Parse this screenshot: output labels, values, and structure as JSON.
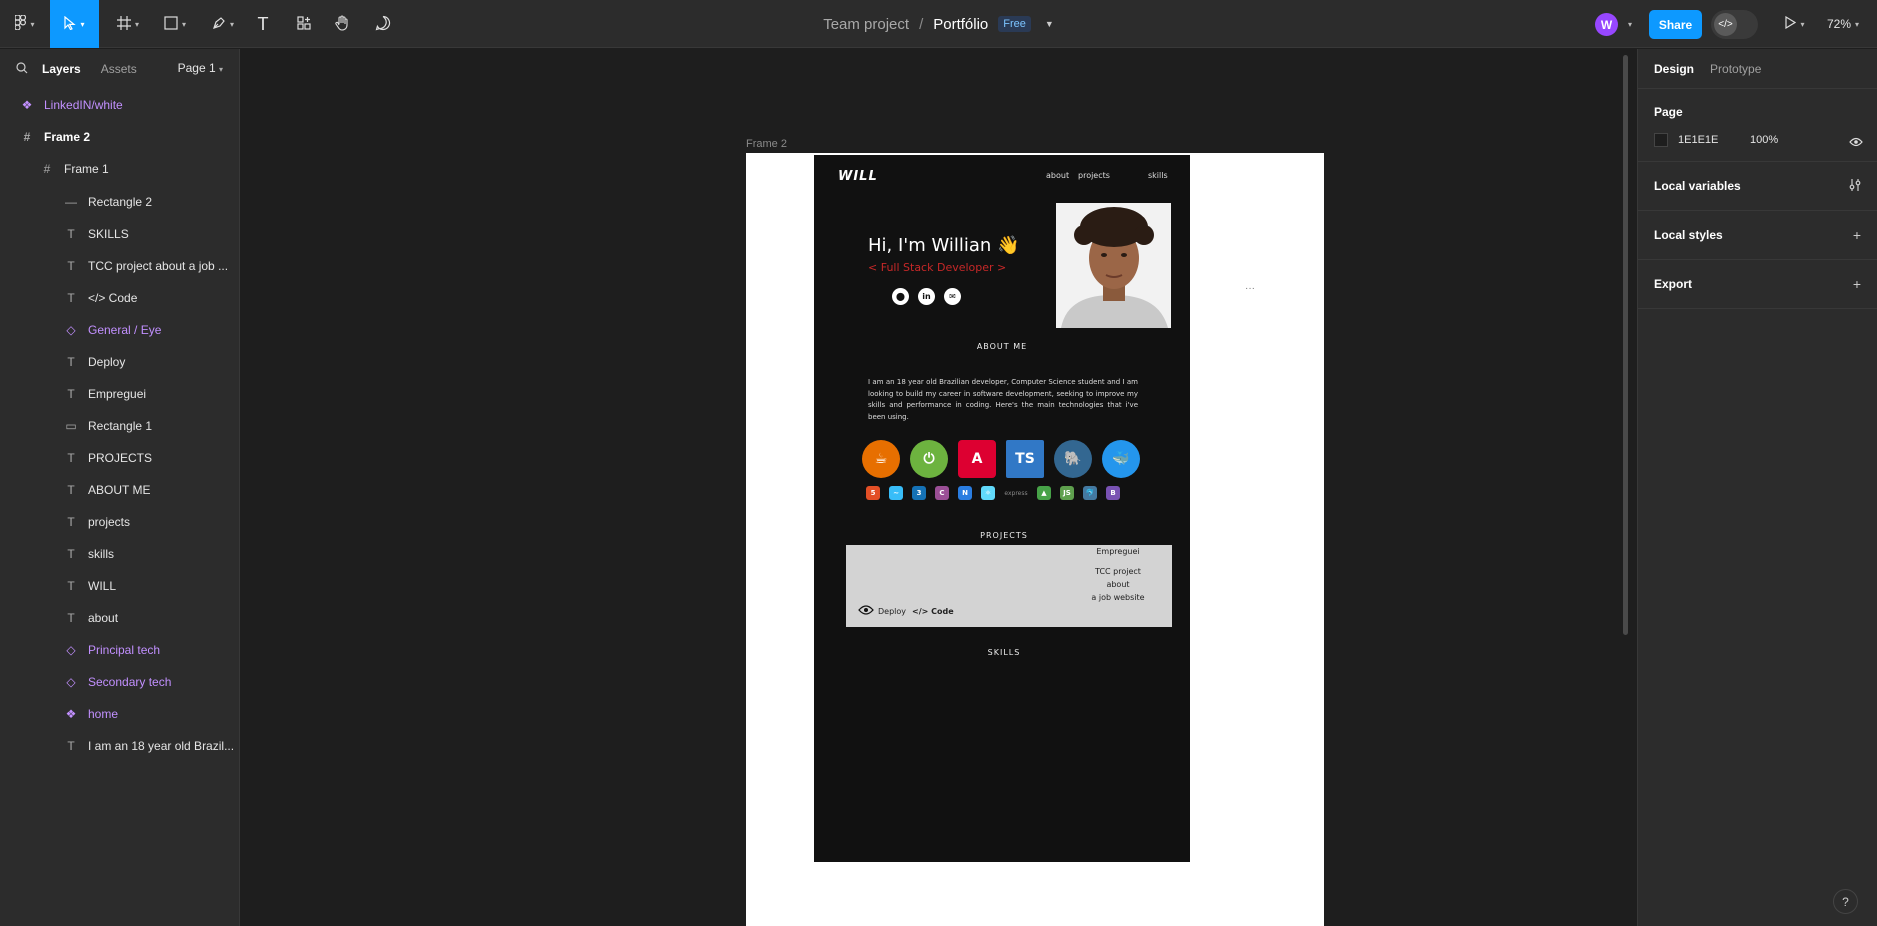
{
  "toolbar": {
    "tools": [
      {
        "name": "main-menu",
        "icon": "figma-logo-icon"
      },
      {
        "name": "move",
        "icon": "cursor-icon"
      },
      {
        "name": "frame",
        "icon": "hash-frame-icon"
      },
      {
        "name": "shape",
        "icon": "rectangle-icon"
      },
      {
        "name": "pen",
        "icon": "pen-icon"
      },
      {
        "name": "text",
        "icon": "text-icon"
      },
      {
        "name": "resources",
        "icon": "resources-icon"
      },
      {
        "name": "hand",
        "icon": "hand-icon"
      },
      {
        "name": "comment",
        "icon": "comment-icon"
      }
    ],
    "text_glyph": "T",
    "title_team": "Team project",
    "title_sep": "/",
    "title_file": "Portfólio",
    "badge": "Free",
    "avatar_initial": "W",
    "share_label": "Share",
    "devmode_glyph": "</>",
    "zoom": "72%",
    "accent": "#0d99ff"
  },
  "left_panel": {
    "tabs": {
      "layers": "Layers",
      "assets": "Assets"
    },
    "page_select": "Page 1",
    "layers": [
      {
        "label": "LinkedIN/white",
        "kind": "component",
        "glyph": "❖"
      },
      {
        "label": "Frame 2",
        "kind": "frame",
        "glyph": "#"
      },
      {
        "label": "Frame 1",
        "kind": "frame",
        "glyph": "#"
      },
      {
        "label": "Rectangle 2",
        "kind": "line",
        "glyph": "—"
      },
      {
        "label": "SKILLS",
        "kind": "text",
        "glyph": "T"
      },
      {
        "label": "TCC project about a job ...",
        "kind": "text",
        "glyph": "T"
      },
      {
        "label": "</> Code",
        "kind": "text",
        "glyph": "T"
      },
      {
        "label": "General / Eye",
        "kind": "instance",
        "glyph": "◇"
      },
      {
        "label": "Deploy",
        "kind": "text",
        "glyph": "T"
      },
      {
        "label": "Empreguei",
        "kind": "text",
        "glyph": "T"
      },
      {
        "label": "Rectangle 1",
        "kind": "rect",
        "glyph": "▭"
      },
      {
        "label": "PROJECTS",
        "kind": "text",
        "glyph": "T"
      },
      {
        "label": "ABOUT ME",
        "kind": "text",
        "glyph": "T"
      },
      {
        "label": "projects",
        "kind": "text",
        "glyph": "T"
      },
      {
        "label": "skills",
        "kind": "text",
        "glyph": "T"
      },
      {
        "label": "WILL",
        "kind": "text",
        "glyph": "T"
      },
      {
        "label": "about",
        "kind": "text",
        "glyph": "T"
      },
      {
        "label": "Principal tech",
        "kind": "instance",
        "glyph": "◇"
      },
      {
        "label": "Secondary tech",
        "kind": "instance",
        "glyph": "◇"
      },
      {
        "label": "home",
        "kind": "component",
        "glyph": "❖"
      },
      {
        "label": "I am an 18 year old Brazil...",
        "kind": "text",
        "glyph": "T"
      }
    ]
  },
  "right_panel": {
    "tabs": {
      "design": "Design",
      "prototype": "Prototype"
    },
    "page_label": "Page",
    "page_color": "1E1E1E",
    "page_opacity": "100%",
    "sections": {
      "local_variables": "Local variables",
      "local_styles": "Local styles",
      "export": "Export"
    },
    "help": "?"
  },
  "canvas": {
    "frame_label": "Frame 2",
    "dots": "···",
    "portfolio": {
      "logo": "WILL",
      "nav": {
        "about": "about",
        "projects": "projects",
        "skills": "skills"
      },
      "hero_title": "Hi, I'm Willian 👋",
      "hero_sub": "< Full Stack Developer >",
      "socials": [
        "github-icon",
        "linkedin-icon",
        "mail-icon"
      ],
      "social_glyphs": {
        "github": "⬤",
        "linkedin": "in",
        "mail": "✉"
      },
      "about_title": "ABOUT ME",
      "about_text": "I am an 18 year old Brazilian developer, Computer Science student and I am looking to build my career in software development, seeking to improve my skills and performance in coding. Here's the main technologies that i've been using.",
      "principal_tech": [
        {
          "name": "java-icon",
          "glyph": "☕",
          "color": "#e76f00"
        },
        {
          "name": "spring-icon",
          "glyph": "⏻",
          "color": "#6db33f"
        },
        {
          "name": "angular-icon",
          "glyph": "A",
          "color": "#dd0031"
        },
        {
          "name": "typescript-icon",
          "glyph": "TS",
          "color": "#3178c6"
        },
        {
          "name": "postgresql-icon",
          "glyph": "🐘",
          "color": "#336791"
        },
        {
          "name": "docker-icon",
          "glyph": "🐳",
          "color": "#2496ed"
        }
      ],
      "secondary_tech": [
        {
          "name": "html5-icon",
          "glyph": "5",
          "color": "#e34f26"
        },
        {
          "name": "tailwind-icon",
          "glyph": "~",
          "color": "#38bdf8"
        },
        {
          "name": "css3-icon",
          "glyph": "3",
          "color": "#1572b6"
        },
        {
          "name": "csharp-icon",
          "glyph": "C",
          "color": "#9b4f96"
        },
        {
          "name": "nativescript-icon",
          "glyph": "N",
          "color": "#2a7de1"
        },
        {
          "name": "react-icon",
          "glyph": "⚛",
          "color": "#61dafb"
        },
        {
          "name": "express-icon",
          "glyph": "express",
          "color": "#888888"
        },
        {
          "name": "mongodb-icon",
          "glyph": "▲",
          "color": "#47a248"
        },
        {
          "name": "nodejs-icon",
          "glyph": "JS",
          "color": "#5fa04e"
        },
        {
          "name": "mysql-icon",
          "glyph": "🐬",
          "color": "#4479a1"
        },
        {
          "name": "bootstrap-icon",
          "glyph": "B",
          "color": "#7952b3"
        }
      ],
      "projects_title": "PROJECTS",
      "project": {
        "title": "Empreguei",
        "desc_lines": [
          "TCC project",
          "about",
          "a job website"
        ],
        "deploy": "Deploy",
        "code": "</> Code"
      },
      "skills_title": "SKILLS"
    }
  }
}
